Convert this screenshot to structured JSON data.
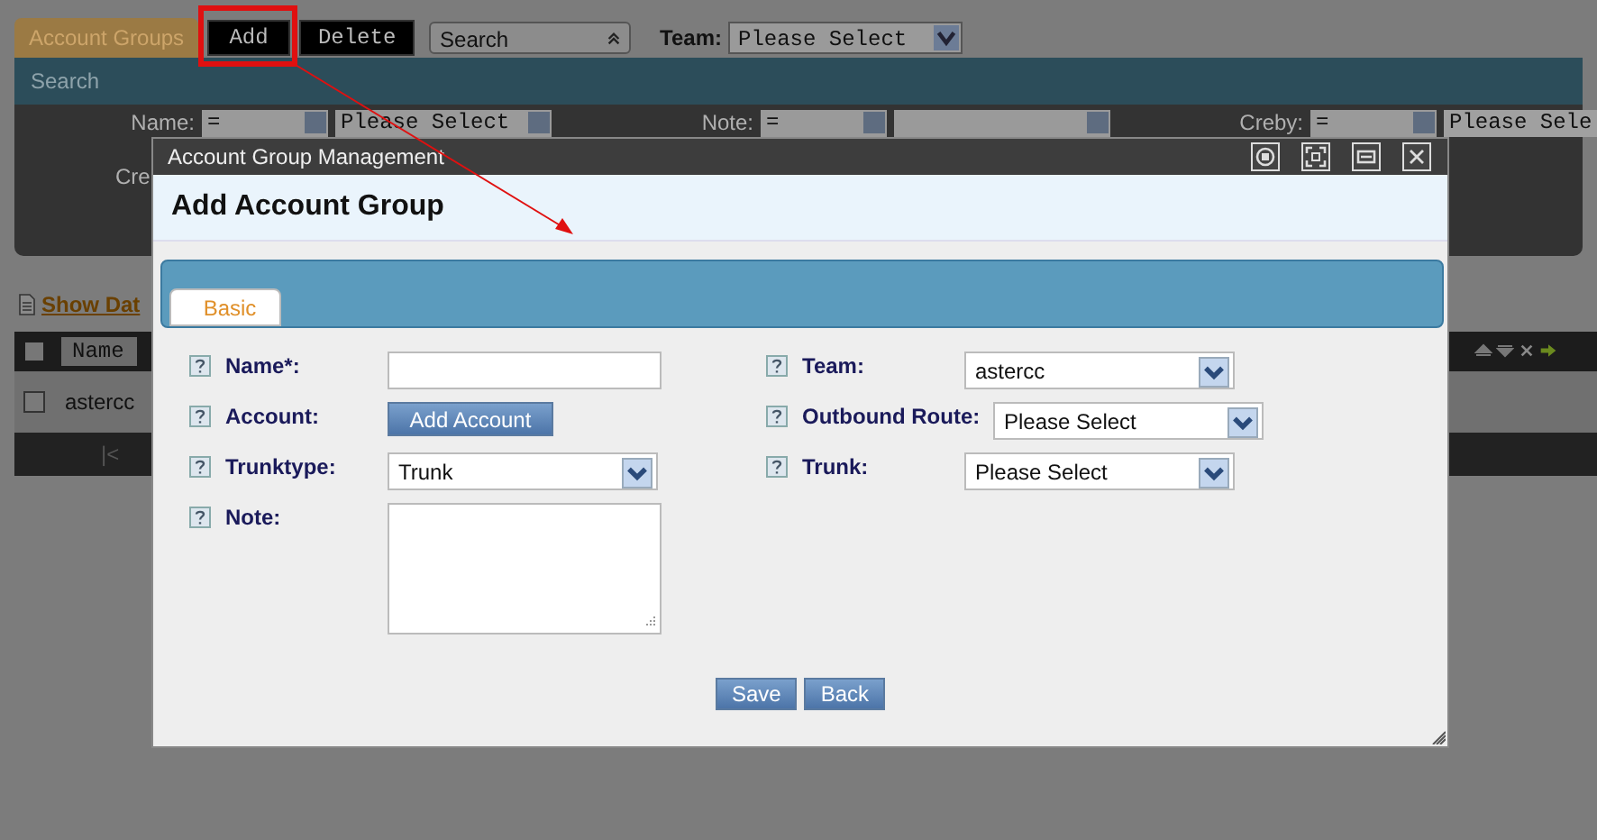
{
  "toolbar": {
    "tab": "Account Groups",
    "buttons": [
      "Add",
      "Delete"
    ],
    "search_select": "Search",
    "team_label": "Team:",
    "team_select": "Please Select"
  },
  "search_panel": {
    "title": "Search",
    "filters": [
      {
        "label": "Name:",
        "operator": "=",
        "value": "Please Select"
      },
      {
        "label": "Note:",
        "operator": "="
      },
      {
        "label": "Creby:",
        "operator": "=",
        "value": "Please Sele"
      }
    ],
    "second_row_label": "Cre"
  },
  "show_data": "Show Dat",
  "table": {
    "header_checked": false,
    "columns": [
      "Name"
    ],
    "rows": [
      {
        "name": "astercc",
        "checked": false
      }
    ],
    "pager": "|<"
  },
  "dialog": {
    "title": "Account Group Management",
    "heading": "Add Account Group",
    "tabs": [
      {
        "label": "Basic",
        "selected": true
      }
    ],
    "left_fields": [
      {
        "label": "Name*:",
        "kind": "text"
      },
      {
        "label": "Account:",
        "kind": "button",
        "value": "Add Account"
      },
      {
        "label": "Trunktype:",
        "kind": "select",
        "value": "Trunk"
      },
      {
        "label": "Note:",
        "kind": "textarea"
      }
    ],
    "right_fields": [
      {
        "label": "Team:",
        "kind": "select",
        "value": "astercc"
      },
      {
        "label": "Outbound Route:",
        "kind": "select",
        "value": "Please Select"
      },
      {
        "label": "Trunk:",
        "kind": "select",
        "value": "Please Select"
      }
    ],
    "buttons": [
      "Save",
      "Back"
    ]
  }
}
